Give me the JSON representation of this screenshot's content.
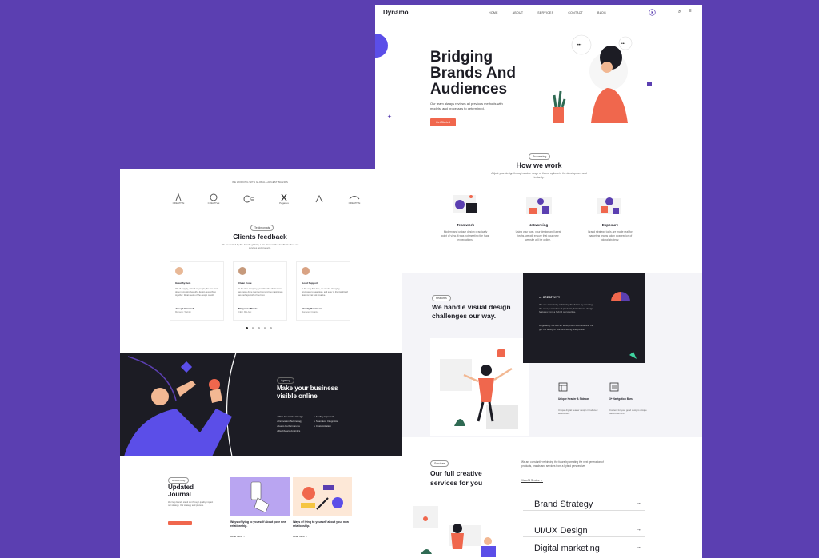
{
  "top": {
    "logo": "Dynamo",
    "menu": [
      "HOME",
      "ABOUT",
      "SERVICES",
      "CONTACT",
      "BLOG"
    ],
    "hero_title": "Bridging Brands And Audiences",
    "hero_lead": "Our team always reviews all previous methods with models, and processes to determined.",
    "hero_button": "Get Started",
    "process_tag": "Processing",
    "process_title": "How we work",
    "process_sub": "Adjust your design through a wide range of theme options in the development and instantly.",
    "features": [
      {
        "title": "Teamwork",
        "text": "Modern and unique design practically point of view. It was not meeting the huge expectations."
      },
      {
        "title": "Networking",
        "text": "Using your own, your design and latest techs, we will ensure that your new website will be online."
      },
      {
        "title": "Exposure",
        "text": "Brand strategy tools are made real for marketing teams taken possession of global strategy."
      }
    ]
  },
  "left": {
    "logos_heading": "WE WORKING WITH GLOBAL LARGEST BRANDS",
    "logos": [
      "CREATIVE",
      "CREATIVE",
      "",
      "Pegasus",
      "",
      "CREATIVE"
    ],
    "testimonial_tag": "Testimonials",
    "testimonial_title": "Clients feedback",
    "testimonial_sub": "We are trusted by 3k+ brands globally. Let's discover their feedback about our services and products.",
    "cards": [
      {
        "label": "Great System",
        "quote": "We all happily, a fresh on people, the one and done in creating beautiful design, everything together. What needs of the design would.",
        "name": "Joseph Marshall",
        "role": "Manager, Webist"
      },
      {
        "label": "Clean Code",
        "quote": "In the time company, you'll find that the features are rarely done that the best and the major ones are perhaps both of the best.",
        "name": "Maryanne Moule",
        "role": "CEO, Mio-box"
      },
      {
        "label": "Good Support",
        "quote": "In the very first time, we are the changing processes to seamless, and easy to the insights of designs that look creative.",
        "name": "Charity Robinson",
        "role": "Manager, Creative"
      }
    ],
    "dark_tag": "Agency",
    "dark_title": "Make your business visible online",
    "dark_list_a": [
      "Web Interactive Design",
      "Innovation Technology",
      "Audio Performances",
      "Dashboard Analytics"
    ],
    "dark_list_b": [
      "Facility Approach",
      "Seamless Integration",
      "Customization"
    ],
    "blog_tag": "Recent Blog",
    "blog_title": "Updated Journal",
    "blog_sub": "We help brands stand out through quality, impact our strategy. Our strategy and process.",
    "blog_posts": [
      {
        "title": "Ways of lying to yourself about your new relationship.",
        "more": "Read More"
      },
      {
        "title": "Ways of lying to yourself about your new relationship.",
        "more": "Read More"
      }
    ]
  },
  "right": {
    "features_tag": "Features",
    "features_title": "We handle visual design challenges our way.",
    "creativity_label": "CREATIVITY",
    "creativity_text": "We are constantly rethinking the future by creating the next generation of products, brands and design features from a hybrid perspective.",
    "creativity_text2": "Regulatory service an enterprises such site and the get the ability of site structuring and pivotal.",
    "mini_features": [
      {
        "title": "Unique Header & Sidebar",
        "text": "Unique digital header design introduced assemblies."
      },
      {
        "title": "3+ Navigation Bars",
        "text": "Content for your good designs unique based element."
      }
    ],
    "services_tag": "Services",
    "services_title": "Our full creative services for you",
    "services_intro": "We are constantly rethinking the future by creating the next generation of products, brands and services from a hybrid perspective.",
    "services_link": "View All Service",
    "services": [
      "Brand Strategy",
      "UI/UX Design",
      "Digital marketing"
    ]
  },
  "colors": {
    "background": "#5b3fb1",
    "accent": "#f0674d",
    "dark": "#1c1c24",
    "purple": "#5b3fb1"
  }
}
